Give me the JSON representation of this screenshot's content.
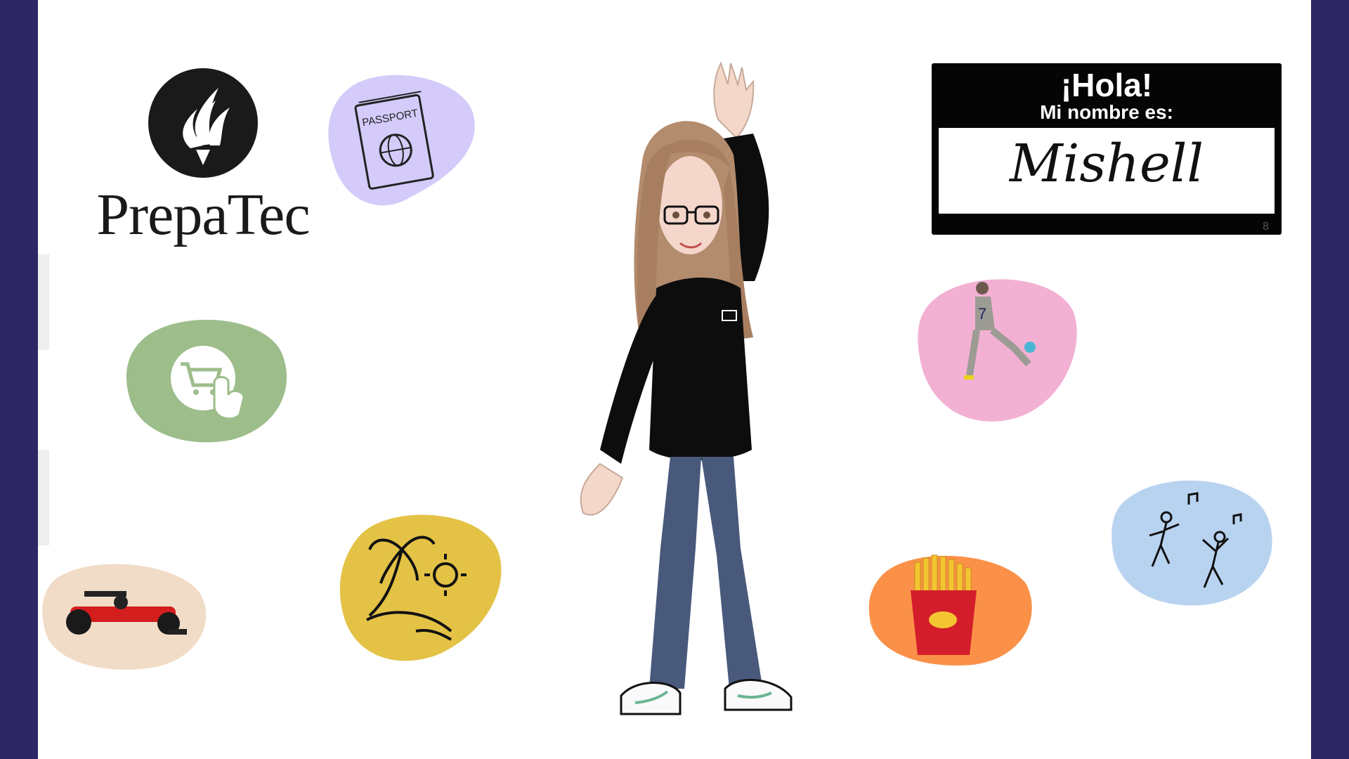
{
  "logo": {
    "text": "PrepaTec"
  },
  "nametag": {
    "greeting": "¡Hola!",
    "subtitle": "Mi nombre es:",
    "name": "Mishell",
    "corner_mark": "8"
  },
  "passport": {
    "label": "PASSPORT"
  },
  "colors": {
    "background": "#2e2766",
    "canvas": "#ffffff",
    "passport_blob": "#d5cbfa",
    "shopping_blob": "#9dbd8a",
    "f1_blob": "#f1dcc7",
    "beach_blob": "#e3c246",
    "soccer_blob": "#f2b1d3",
    "fries_blob": "#fb9148",
    "dance_blob": "#b8d3f0"
  },
  "icons": [
    "torch-logo-icon",
    "passport-icon",
    "shopping-cart-touch-icon",
    "race-car-icon",
    "palm-tree-sun-icon",
    "soccer-player-icon",
    "french-fries-icon",
    "dancing-people-icon"
  ]
}
